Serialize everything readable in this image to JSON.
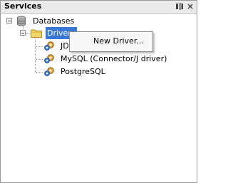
{
  "panel": {
    "title": "Services",
    "minimize_icon": "minimize-icon",
    "close_icon": "close-icon"
  },
  "tree": {
    "databases": {
      "label": "Databases",
      "icon": "database-icon"
    },
    "drivers": {
      "label": "Drivers",
      "icon": "folder-icon",
      "selected": true
    },
    "children": [
      {
        "label": "JD",
        "icon": "driver-gear-icon"
      },
      {
        "label": "MySQL (Connector/J driver)",
        "icon": "driver-gear-icon"
      },
      {
        "label": "PostgreSQL",
        "icon": "driver-gear-icon"
      }
    ]
  },
  "context_menu": {
    "items": [
      {
        "label": "New Driver..."
      }
    ]
  },
  "colors": {
    "selection": "#3a78d6",
    "titlebar": "#eaeaea",
    "menu_bg": "#f7f7f7"
  }
}
